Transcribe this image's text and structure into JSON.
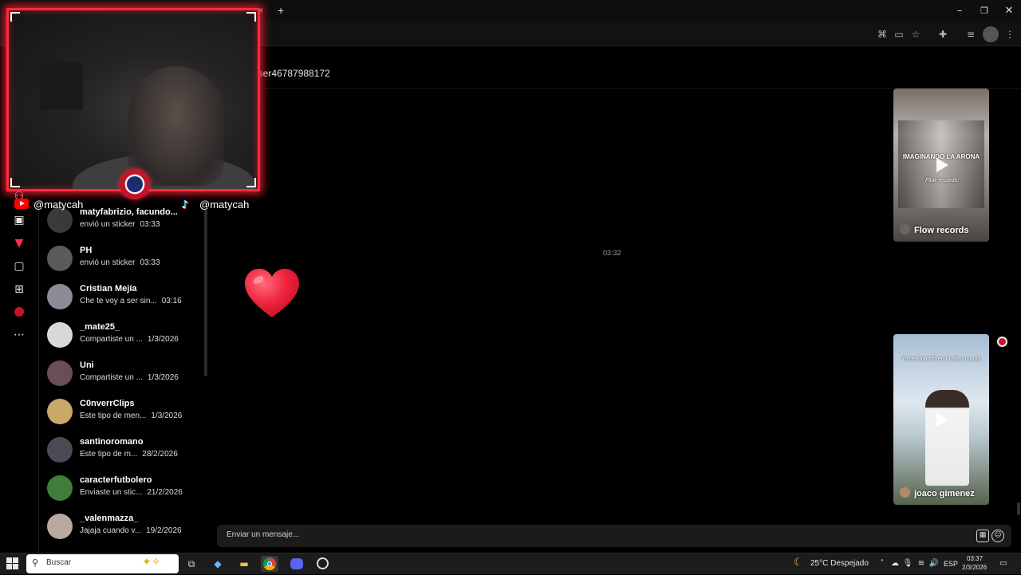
{
  "browser": {
    "tab_close": "×",
    "new_tab": "+",
    "window_controls": [
      "–",
      "❐",
      "✕"
    ],
    "toolbar_icons": [
      "translate-icon",
      "cast-icon",
      "bookmark-star-icon",
      "extensions-icon",
      "tab-search-icon",
      "profile-icon",
      "menu-icon"
    ]
  },
  "stream_overlay": {
    "youtube_handle": "@matycah",
    "tiktok_handle": "@matycah",
    "accent_color": "#ff2b3a"
  },
  "rail": {
    "icons": [
      "explore-icon",
      "live-icon",
      "for-you-icon",
      "messages-icon",
      "upload-icon",
      "profile-avatar-icon",
      "more-icon"
    ]
  },
  "conversations": [
    {
      "name": "matyfabrizio, facundo...",
      "preview": "envió un sticker",
      "time": "03:33",
      "avatar_color": "#3a3a3a"
    },
    {
      "name": "PH",
      "preview": "envió un sticker",
      "time": "03:33",
      "avatar_color": "#5a5a5a"
    },
    {
      "name": "Cristian Mejía",
      "preview": "Che te voy a ser sin...",
      "time": "03:16",
      "avatar_color": "#8c8c96"
    },
    {
      "name": "_mate25_",
      "preview": "Compartiste un ...",
      "time": "1/3/2026",
      "avatar_color": "#d8d8d8"
    },
    {
      "name": "Uni",
      "preview": "Compartiste un ...",
      "time": "1/3/2026",
      "avatar_color": "#6a4e55"
    },
    {
      "name": "C0nverrClips",
      "preview": "Este tipo de men...",
      "time": "1/3/2026",
      "avatar_color": "#c9a86a"
    },
    {
      "name": "santinoromano",
      "preview": "Este tipo de m...",
      "time": "28/2/2026",
      "avatar_color": "#4d4a55"
    },
    {
      "name": "caracterfutbolero",
      "preview": "Enviaste un stic...",
      "time": "21/2/2026",
      "avatar_color": "#3f7d3a"
    },
    {
      "name": "_valenmazza_",
      "preview": "Jajaja cuando v...",
      "time": "19/2/2026",
      "avatar_color": "#b9a9a0"
    }
  ],
  "chat": {
    "header_username": "user46787988172",
    "timestamp": "03:32",
    "videos": [
      {
        "author": "Flow records",
        "overlay_text": "IMAGINANDO LA ARONA",
        "sub_text": "Flow records",
        "palette": [
          "#8a7f74",
          "#c3c0bb",
          "#5e5a57"
        ]
      },
      {
        "author": "joaco gimenez",
        "overlay_text": "Yo rearmando en lo alto su aura",
        "sub_text": "",
        "palette": [
          "#9fb6cf",
          "#dbe6ef",
          "#5f6e57"
        ]
      }
    ]
  },
  "message_input": {
    "placeholder": "Enviar un mensaje..."
  },
  "taskbar": {
    "search_label": "Buscar",
    "apps": [
      "task-view-icon",
      "copilot-icon",
      "file-explorer-icon",
      "chrome-icon",
      "discord-icon",
      "obs-icon"
    ],
    "weather": "25°C  Despejado",
    "language": "ESP",
    "time": "03:37",
    "date": "2/3/2026"
  }
}
